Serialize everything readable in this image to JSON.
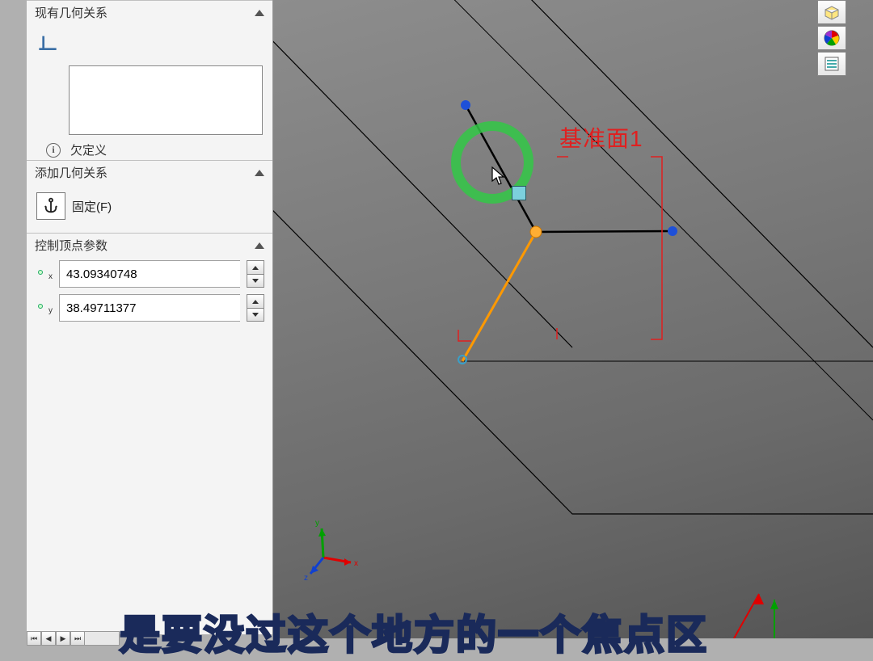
{
  "panel": {
    "section_existing": {
      "title": "现有几何关系"
    },
    "status": {
      "icon_text": "i",
      "text": "欠定义"
    },
    "section_add": {
      "title": "添加几何关系",
      "fixed_label": "固定(F)"
    },
    "section_ctrl": {
      "title": "控制顶点参数",
      "x_label": "x",
      "x_value": "43.09340748",
      "y_label": "y",
      "y_value": "38.49711377"
    }
  },
  "viewport": {
    "datum_name": "基准面1",
    "triad": {
      "x": "x",
      "y": "y",
      "z": "z"
    }
  },
  "subtitle": "是要没过这个地方的一个焦点区"
}
